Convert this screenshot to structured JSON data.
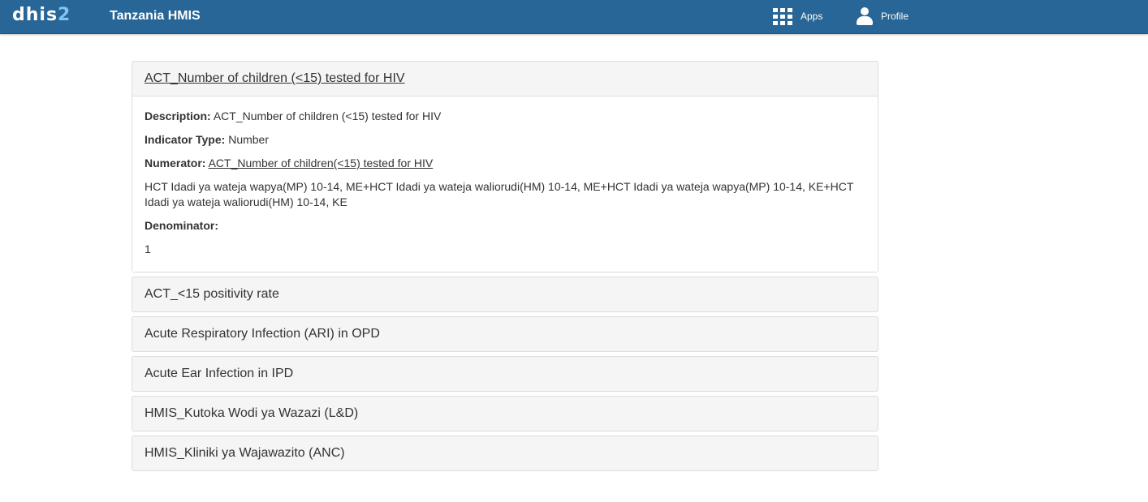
{
  "header": {
    "logo_main": "dhis",
    "logo_num": "2",
    "title": "Tanzania HMIS",
    "nav": {
      "apps_label": "Apps",
      "profile_label": "Profile"
    },
    "colors": {
      "bar": "#276696",
      "logo_accent": "#7fc4f5"
    }
  },
  "indicators": [
    {
      "name": "ACT_Number of children (<15) tested for HIV",
      "expanded": true,
      "details": {
        "description_label": "Description:",
        "description": "ACT_Number of children (<15) tested for HIV",
        "type_label": "Indicator Type:",
        "type": "Number",
        "numerator_label": "Numerator:",
        "numerator_link": "ACT_Number of children(<15) tested for HIV",
        "numerator_formula": "HCT Idadi ya wateja wapya(MP) 10-14, ME+HCT Idadi ya wateja waliorudi(HM) 10-14, ME+HCT Idadi ya wateja wapya(MP) 10-14, KE+HCT Idadi ya wateja waliorudi(HM) 10-14, KE",
        "denominator_label": "Denominator:",
        "denominator": "1"
      }
    },
    {
      "name": "ACT_<15 positivity rate",
      "expanded": false
    },
    {
      "name": "Acute Respiratory Infection (ARI) in OPD",
      "expanded": false
    },
    {
      "name": "Acute Ear Infection in IPD",
      "expanded": false
    },
    {
      "name": "HMIS_Kutoka Wodi ya Wazazi (L&D)",
      "expanded": false
    },
    {
      "name": "HMIS_Kliniki ya Wajawazito (ANC)",
      "expanded": false
    }
  ]
}
